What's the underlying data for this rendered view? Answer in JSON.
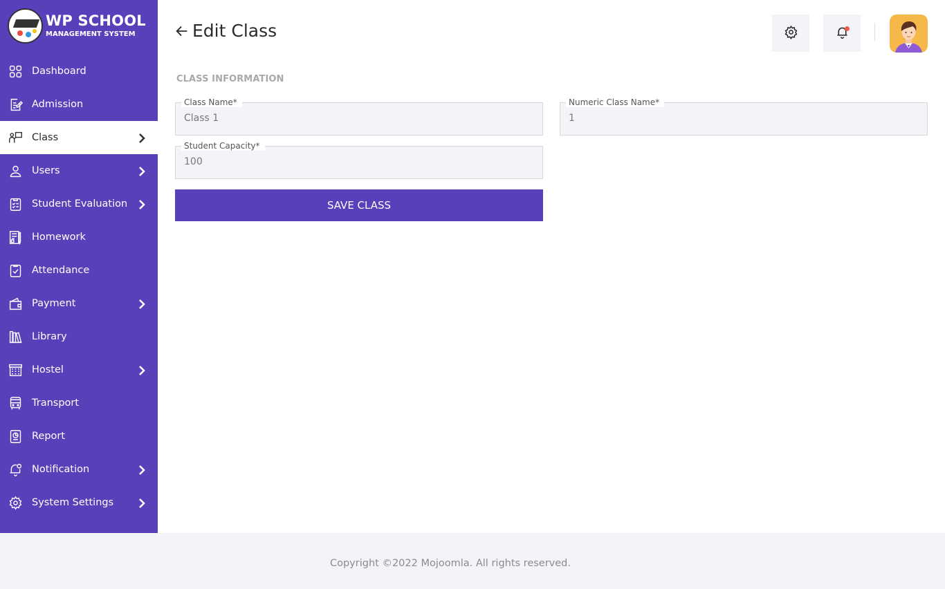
{
  "brand": {
    "title": "WP SCHOOL",
    "subtitle": "MANAGEMENT SYSTEM",
    "accent": "#5840bb"
  },
  "sidebar": {
    "items": [
      {
        "label": "Dashboard",
        "icon": "grid-icon",
        "has_submenu": false,
        "active": false
      },
      {
        "label": "Admission",
        "icon": "edit-document-icon",
        "has_submenu": false,
        "active": false
      },
      {
        "label": "Class",
        "icon": "classroom-icon",
        "has_submenu": true,
        "active": true
      },
      {
        "label": "Users",
        "icon": "user-icon",
        "has_submenu": true,
        "active": false
      },
      {
        "label": "Student Evaluation",
        "icon": "checklist-icon",
        "has_submenu": true,
        "active": false
      },
      {
        "label": "Homework",
        "icon": "notebook-icon",
        "has_submenu": false,
        "active": false
      },
      {
        "label": "Attendance",
        "icon": "clipboard-check-icon",
        "has_submenu": false,
        "active": false
      },
      {
        "label": "Payment",
        "icon": "wallet-icon",
        "has_submenu": true,
        "active": false
      },
      {
        "label": "Library",
        "icon": "books-icon",
        "has_submenu": false,
        "active": false
      },
      {
        "label": "Hostel",
        "icon": "building-icon",
        "has_submenu": true,
        "active": false
      },
      {
        "label": "Transport",
        "icon": "bus-icon",
        "has_submenu": false,
        "active": false
      },
      {
        "label": "Report",
        "icon": "report-icon",
        "has_submenu": false,
        "active": false
      },
      {
        "label": "Notification",
        "icon": "bell-alert-icon",
        "has_submenu": true,
        "active": false
      },
      {
        "label": "System Settings",
        "icon": "gear-icon",
        "has_submenu": true,
        "active": false
      }
    ]
  },
  "header": {
    "title": "Edit Class"
  },
  "form": {
    "section_label": "CLASS INFORMATION",
    "class_name": {
      "label": "Class Name*",
      "value": "Class 1"
    },
    "numeric_class_name": {
      "label": "Numeric Class Name*",
      "value": "1"
    },
    "student_capacity": {
      "label": "Student Capacity*",
      "value": "100"
    },
    "save_label": "SAVE CLASS"
  },
  "footer": {
    "copyright": "Copyright ©2022 Mojoomla. All rights reserved."
  }
}
